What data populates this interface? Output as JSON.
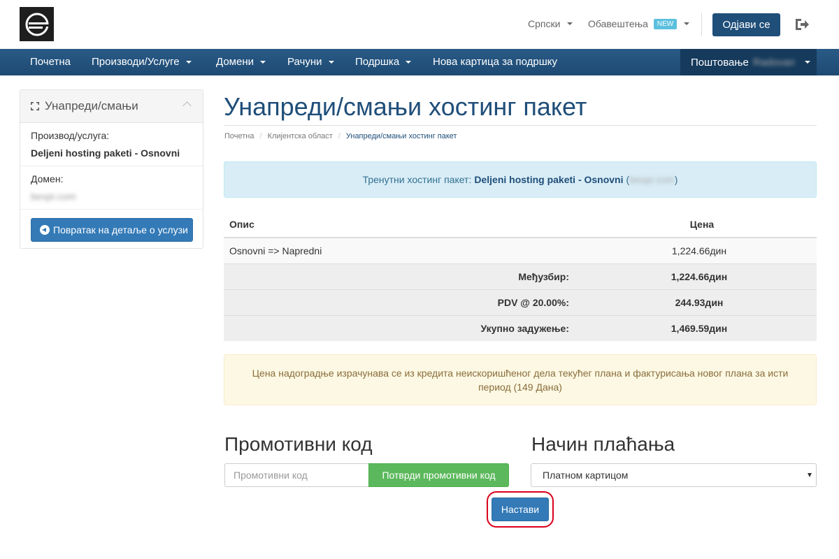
{
  "header": {
    "language": "Српски",
    "notifications": "Обавештења",
    "notifications_badge": "NEW",
    "logout": "Одјави се"
  },
  "nav": {
    "items": [
      "Почетна",
      "Производи/Услуге",
      "Домени",
      "Рачуни",
      "Подршка",
      "Нова картица за подршку"
    ],
    "greeting": "Поштовање",
    "user_name": "Radovan"
  },
  "sidebar": {
    "title": "Унапреди/смањи",
    "product_label": "Производ/услуга:",
    "product_value": "Deljeni hosting paketi - Osnovni",
    "domain_label": "Домен:",
    "domain_value": "bexpr.com",
    "back_button": "Повратак на детаље о услузи"
  },
  "main": {
    "title": "Унапреди/смањи хостинг пакет",
    "breadcrumb": [
      "Почетна",
      "Клијентска област",
      "Унапреди/смањи хостинг пакет"
    ],
    "current_prefix": "Тренутни хостинг пакет:",
    "current_package": "Deljeni hosting paketi - Osnovni",
    "current_domain": "bexpr.com",
    "table": {
      "col_desc": "Опис",
      "col_price": "Цена",
      "item_desc": "Osnovni => Napredni",
      "item_price": "1,224.66дин",
      "subtotal_label": "Међузбир:",
      "subtotal_value": "1,224.66дин",
      "tax_label": "PDV @ 20.00%:",
      "tax_value": "244.93дин",
      "total_label": "Укупно задужење:",
      "total_value": "1,469.59дин"
    },
    "notice": "Цена надоградње израчунава се из кредита неискоришћеног дела текућег плана и фактурисања новог плана за исти период (149 Дана)",
    "promo_title": "Промотивни код",
    "promo_placeholder": "Промотивни код",
    "promo_button": "Потврди промотивни код",
    "payment_title": "Начин плаћања",
    "payment_selected": "Платном картицом",
    "continue_button": "Настави"
  },
  "colors": {
    "brand": "#1f4e79",
    "nav_bg": "#255580",
    "success": "#5cb85c",
    "highlight_ring": "#d9001b"
  }
}
